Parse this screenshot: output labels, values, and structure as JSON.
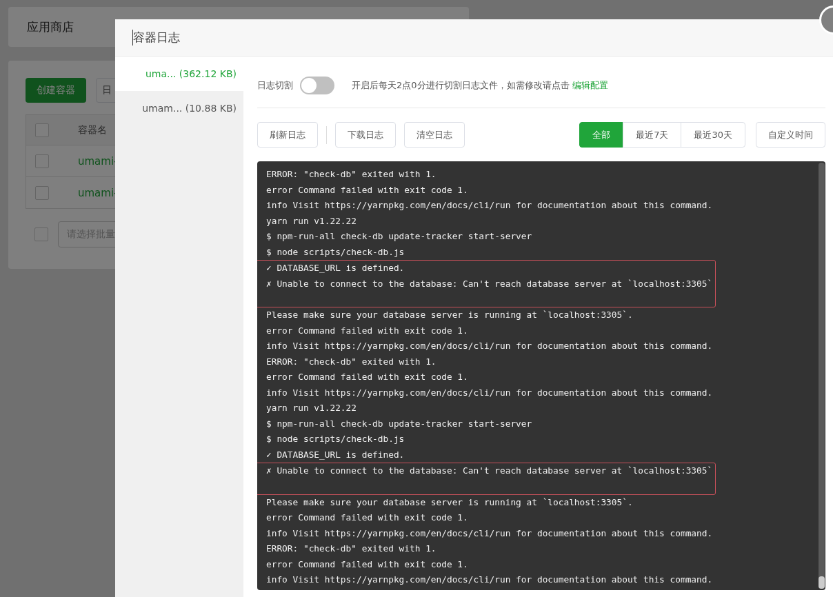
{
  "page": {
    "title": "应用商店",
    "create_button": "创建容器",
    "second_button": "日",
    "table": {
      "header": "容器名",
      "all_checked": false,
      "rows": [
        {
          "name": "umami-",
          "checked": false
        },
        {
          "name": "umami-",
          "checked": false
        }
      ]
    },
    "batch_checked": false,
    "batch_select": {
      "placeholder": "请选择批量"
    }
  },
  "dialog": {
    "title": "容器日志",
    "files": [
      {
        "name": "uma...",
        "size": "(362.12 KB)",
        "selected": true
      },
      {
        "name": "umam...",
        "size": "(10.88 KB)",
        "selected": false
      }
    ],
    "rotation": {
      "label": "日志切割",
      "on": false,
      "hint": "开启后每天2点0分进行切割日志文件，如需修改请点击",
      "link": "编辑配置"
    },
    "actions": [
      "刷新日志",
      "下载日志",
      "清空日志"
    ],
    "ranges": [
      {
        "label": "全部",
        "selected": true
      },
      {
        "label": "最近7天",
        "selected": false
      },
      {
        "label": "最近30天",
        "selected": false
      }
    ],
    "custom_range": "自定义时间",
    "log": [
      {
        "kind": "line",
        "text": "ERROR: \"check-db\" exited with 1."
      },
      {
        "kind": "line",
        "text": "error Command failed with exit code 1."
      },
      {
        "kind": "line",
        "text": "info Visit https://yarnpkg.com/en/docs/cli/run for documentation about this command."
      },
      {
        "kind": "line",
        "text": "yarn run v1.22.22"
      },
      {
        "kind": "line",
        "text": "$ npm-run-all check-db update-tracker start-server"
      },
      {
        "kind": "line",
        "text": "$ node scripts/check-db.js"
      },
      {
        "kind": "highlight",
        "lines": [
          "✓ DATABASE_URL is defined.",
          "✗ Unable to connect to the database: Can't reach database server at `localhost:3305`"
        ]
      },
      {
        "kind": "line",
        "text": "Please make sure your database server is running at `localhost:3305`."
      },
      {
        "kind": "line",
        "text": "error Command failed with exit code 1."
      },
      {
        "kind": "line",
        "text": "info Visit https://yarnpkg.com/en/docs/cli/run for documentation about this command."
      },
      {
        "kind": "line",
        "text": "ERROR: \"check-db\" exited with 1."
      },
      {
        "kind": "line",
        "text": "error Command failed with exit code 1."
      },
      {
        "kind": "line",
        "text": "info Visit https://yarnpkg.com/en/docs/cli/run for documentation about this command."
      },
      {
        "kind": "line",
        "text": "yarn run v1.22.22"
      },
      {
        "kind": "line",
        "text": "$ npm-run-all check-db update-tracker start-server"
      },
      {
        "kind": "line",
        "text": "$ node scripts/check-db.js"
      },
      {
        "kind": "line",
        "text": "✓ DATABASE_URL is defined."
      },
      {
        "kind": "highlight",
        "lines": [
          "✗ Unable to connect to the database: Can't reach database server at `localhost:3305`"
        ]
      },
      {
        "kind": "line",
        "text": "Please make sure your database server is running at `localhost:3305`."
      },
      {
        "kind": "line",
        "text": "error Command failed with exit code 1."
      },
      {
        "kind": "line",
        "text": "info Visit https://yarnpkg.com/en/docs/cli/run for documentation about this command."
      },
      {
        "kind": "line",
        "text": "ERROR: \"check-db\" exited with 1."
      },
      {
        "kind": "line",
        "text": "error Command failed with exit code 1."
      },
      {
        "kind": "line",
        "text": "info Visit https://yarnpkg.com/en/docs/cli/run for documentation about this command."
      }
    ]
  }
}
